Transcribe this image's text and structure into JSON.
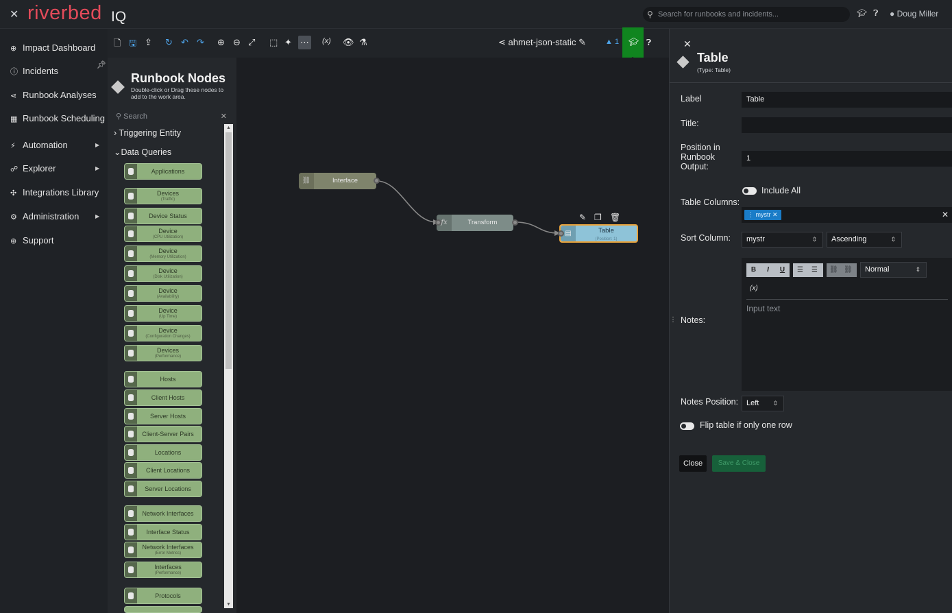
{
  "app": {
    "brand": "riverbed",
    "product": "IQ",
    "search_placeholder": "Search for runbooks and incidents...",
    "user": "Doug Miller"
  },
  "nav": {
    "items": [
      {
        "label": "Impact Dashboard",
        "icon": "globe-icon"
      },
      {
        "label": "Incidents",
        "icon": "alert-circle-icon"
      },
      {
        "label": "Runbook Analyses",
        "icon": "share-icon"
      },
      {
        "label": "Runbook Scheduling",
        "icon": "calendar-icon"
      },
      {
        "label": "Automation",
        "icon": "bolt-icon"
      },
      {
        "label": "Explorer",
        "icon": "explorer-icon"
      },
      {
        "label": "Integrations Library",
        "icon": "puzzle-icon"
      },
      {
        "label": "Administration",
        "icon": "gear-icon"
      },
      {
        "label": "Support",
        "icon": "lifebuoy-icon"
      }
    ]
  },
  "toolbar": {
    "runbook_name": "ahmet-json-static",
    "variables_label": "(x)",
    "warning_count": "1"
  },
  "palette": {
    "title": "Runbook Nodes",
    "subtitle": "Double-click or Drag these nodes to add to the work area.",
    "search_placeholder": "Search",
    "groups": [
      {
        "label": "Triggering Entity",
        "expanded": false
      },
      {
        "label": "Data Queries",
        "expanded": true
      }
    ],
    "nodes": [
      {
        "label": "Applications",
        "sub": ""
      },
      {
        "label": "Devices",
        "sub": "(Traffic)"
      },
      {
        "label": "Device Status",
        "sub": ""
      },
      {
        "label": "Device",
        "sub": "(CPU Utilization)"
      },
      {
        "label": "Device",
        "sub": "(Memory Utilization)"
      },
      {
        "label": "Device",
        "sub": "(Disk Utilization)"
      },
      {
        "label": "Device",
        "sub": "(Availability)"
      },
      {
        "label": "Device",
        "sub": "(Up Time)"
      },
      {
        "label": "Device",
        "sub": "(Configuration Changes)"
      },
      {
        "label": "Devices",
        "sub": "(Performance)"
      },
      {
        "label": "Hosts",
        "sub": ""
      },
      {
        "label": "Client Hosts",
        "sub": ""
      },
      {
        "label": "Server Hosts",
        "sub": ""
      },
      {
        "label": "Client-Server Pairs",
        "sub": ""
      },
      {
        "label": "Locations",
        "sub": ""
      },
      {
        "label": "Client Locations",
        "sub": ""
      },
      {
        "label": "Server Locations",
        "sub": ""
      },
      {
        "label": "Network Interfaces",
        "sub": ""
      },
      {
        "label": "Interface Status",
        "sub": ""
      },
      {
        "label": "Network Interfaces",
        "sub": "(Error Metrics)"
      },
      {
        "label": "Interfaces",
        "sub": "(Performance)"
      },
      {
        "label": "Protocols",
        "sub": ""
      }
    ]
  },
  "canvas": {
    "nodes": [
      {
        "label": "Interface"
      },
      {
        "label": "Transform",
        "icon_text": "fx"
      },
      {
        "label": "Table",
        "sub": "(Position: 1)"
      }
    ]
  },
  "panel": {
    "title": "Table",
    "type": "(Type: Table)",
    "label_label": "Label",
    "label_value": "Table",
    "title_label": "Title:",
    "title_value": "",
    "position_label": "Position in Runbook Output:",
    "position_value": "1",
    "include_all": "Include All",
    "columns_label": "Table Columns:",
    "column_chip": "mystr",
    "sort_label": "Sort Column:",
    "sort_column": "mystr",
    "sort_order": "Ascending",
    "notes_label": "Notes:",
    "format_value": "Normal",
    "editor_var": "(x)",
    "notes_placeholder": "Input text",
    "notes_position_label": "Notes Position:",
    "notes_position_value": "Left",
    "flip_label": "Flip table if only one row",
    "close_label": "Close",
    "save_label": "Save & Close"
  }
}
